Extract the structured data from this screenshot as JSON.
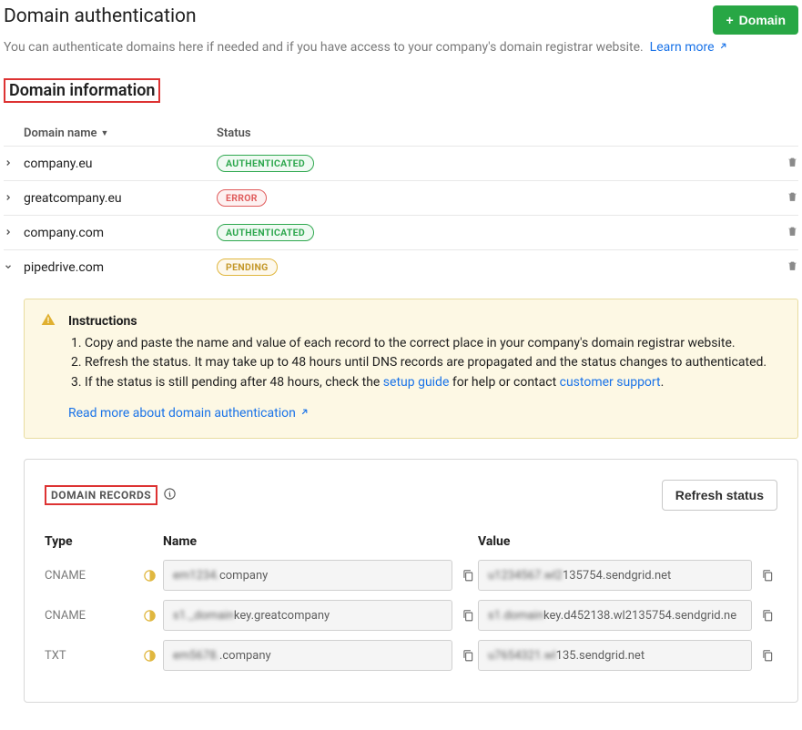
{
  "header": {
    "title": "Domain authentication",
    "add_button": "Domain",
    "subtitle": "You can authenticate domains here if needed and if you have access to your company's domain registrar website.",
    "learn_more": "Learn more"
  },
  "section_title": "Domain information",
  "columns": {
    "name": "Domain name",
    "status": "Status"
  },
  "status_labels": {
    "authenticated": "AUTHENTICATED",
    "error": "ERROR",
    "pending": "PENDING"
  },
  "domains": [
    {
      "name": "company.eu",
      "status": "authenticated",
      "expanded": false
    },
    {
      "name": "greatcompany.eu",
      "status": "error",
      "expanded": false
    },
    {
      "name": "company.com",
      "status": "authenticated",
      "expanded": false
    },
    {
      "name": "pipedrive.com",
      "status": "pending",
      "expanded": true
    }
  ],
  "instructions": {
    "heading": "Instructions",
    "steps": [
      "Copy and paste the name and value of each record to the correct place in your company's domain registrar website.",
      "Refresh the status. It may take up to 48 hours until DNS records are propagated and the status changes to authenticated.",
      "If the status is still pending after 48 hours, check the "
    ],
    "setup_guide": "setup guide",
    "step3_mid": " for help or contact ",
    "customer_support": "customer support",
    "step3_end": ".",
    "read_more": "Read more about domain authentication"
  },
  "records": {
    "title": "DOMAIN RECORDS",
    "refresh": "Refresh status",
    "columns": {
      "type": "Type",
      "name": "Name",
      "value": "Value"
    },
    "rows": [
      {
        "type": "CNAME",
        "name_blur": "em1234.",
        "name_clear": "company",
        "value_blur": "u1234567.wl2",
        "value_clear": "135754.sendgrid.net"
      },
      {
        "type": "CNAME",
        "name_blur": "s1._domain",
        "name_clear": "key.greatcompany",
        "value_blur": "s1.domain",
        "value_clear": "key.d452138.wl2135754.sendgrid.ne"
      },
      {
        "type": "TXT",
        "name_blur": "em5678.",
        "name_clear": ".company",
        "value_blur": "u7654321.wl",
        "value_clear": "135.sendgrid.net"
      }
    ]
  }
}
